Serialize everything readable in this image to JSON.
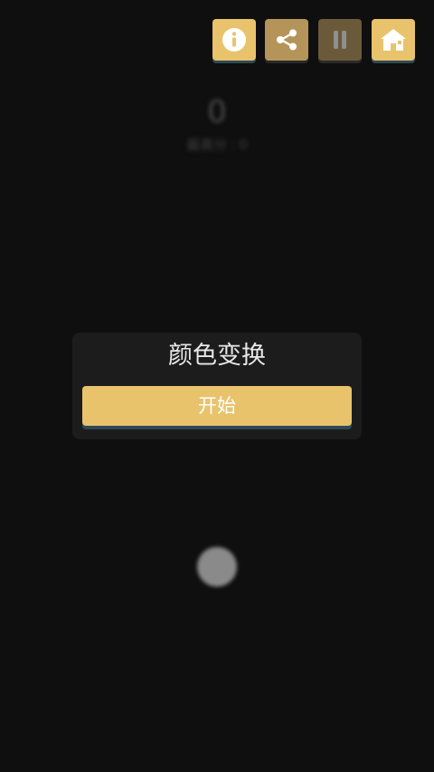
{
  "toolbar": {
    "info_icon": "info-icon",
    "share_icon": "share-icon",
    "pause_icon": "pause-icon",
    "home_icon": "home-icon"
  },
  "score": {
    "current": "0",
    "best_label": "最高分",
    "best_separator": ":",
    "best_value": "0"
  },
  "dialog": {
    "title": "颜色变换",
    "start_label": "开始"
  },
  "colors": {
    "background": "#0f0f0f",
    "accent": "#e8c36c",
    "share_button": "#b5945a",
    "pause_button": "#6b5a3a",
    "dialog_bg": "#1c1c1c",
    "button_shadow": "#2f4a55",
    "ball": "#8a8a8a"
  }
}
